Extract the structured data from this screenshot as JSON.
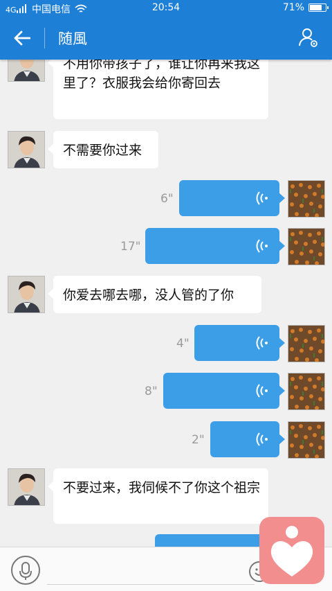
{
  "status_bar": {
    "carrier": "中国电信",
    "time": "20:54",
    "battery": "71%",
    "battery_level": 0.71
  },
  "header": {
    "title": "随風"
  },
  "messages": [
    {
      "type": "text",
      "side": "in",
      "text": "不用你带孩子了，谁让你再来我这里了？衣服我会给你寄回去"
    },
    {
      "type": "text",
      "side": "in",
      "text": "不需要你过来"
    },
    {
      "type": "voice",
      "side": "out",
      "duration": "6\""
    },
    {
      "type": "voice",
      "side": "out",
      "duration": "17\""
    },
    {
      "type": "text",
      "side": "in",
      "text": "你爱去哪去哪，没人管的了你"
    },
    {
      "type": "voice",
      "side": "out",
      "duration": "4\""
    },
    {
      "type": "voice",
      "side": "out",
      "duration": "8\""
    },
    {
      "type": "voice",
      "side": "out",
      "duration": "2\""
    },
    {
      "type": "text",
      "side": "in",
      "text": "不要过来，我伺候不了你这个祖宗"
    }
  ],
  "input": {
    "placeholder": ""
  },
  "icons": {
    "back": "arrow-left-icon",
    "profile": "user-settings-icon",
    "voice": "voice-wave-icon",
    "mic": "microphone-icon",
    "emoji": "emoji-icon",
    "badge": "heart-person-icon"
  },
  "colors": {
    "header": "#1e7fd6",
    "voice_bubble": "#3d9ee8",
    "incoming_bubble": "#ffffff",
    "background": "#f0f0f0",
    "badge": "#f28e8e"
  }
}
